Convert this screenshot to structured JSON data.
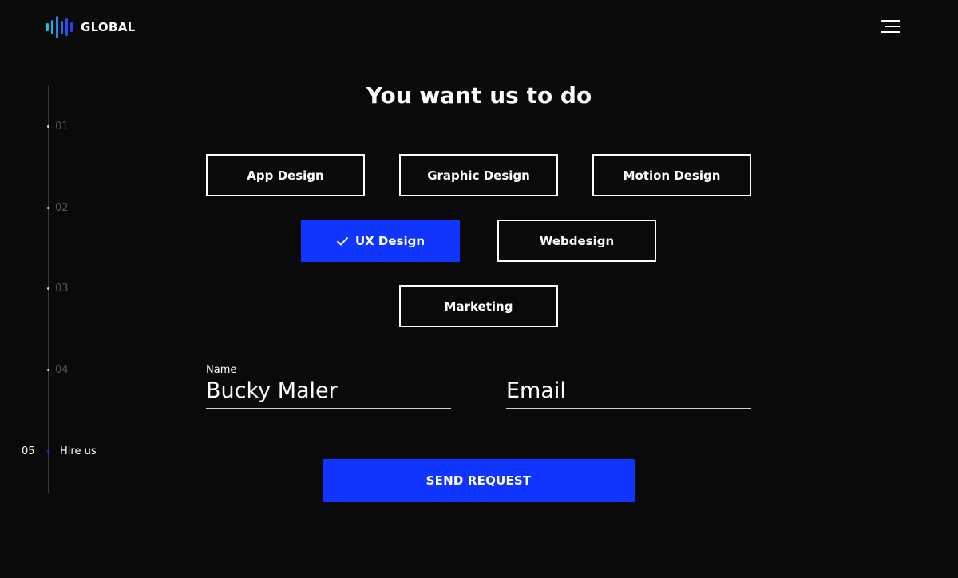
{
  "header": {
    "logo_text": "GLOBAL",
    "menu_icon": "hamburger-menu-icon"
  },
  "steps": [
    {
      "number": "01",
      "label": ""
    },
    {
      "number": "02",
      "label": ""
    },
    {
      "number": "03",
      "label": ""
    },
    {
      "number": "04",
      "label": ""
    },
    {
      "number": "05",
      "label": "Hire us"
    }
  ],
  "active_step": "05",
  "title": "You want us to do",
  "services": [
    {
      "label": "App Design",
      "selected": false
    },
    {
      "label": "Graphic Design",
      "selected": false
    },
    {
      "label": "Motion Design",
      "selected": false
    },
    {
      "label": "UX Design",
      "selected": true
    },
    {
      "label": "Webdesign",
      "selected": false
    },
    {
      "label": "Marketing",
      "selected": false
    }
  ],
  "form": {
    "name_label": "Name",
    "name_value": "Bucky Maler",
    "email_placeholder": "Email",
    "send_label": "SEND REQUEST"
  },
  "colors": {
    "background": "#0a0a0a",
    "accent": "#1035ff",
    "text": "#ffffff"
  }
}
